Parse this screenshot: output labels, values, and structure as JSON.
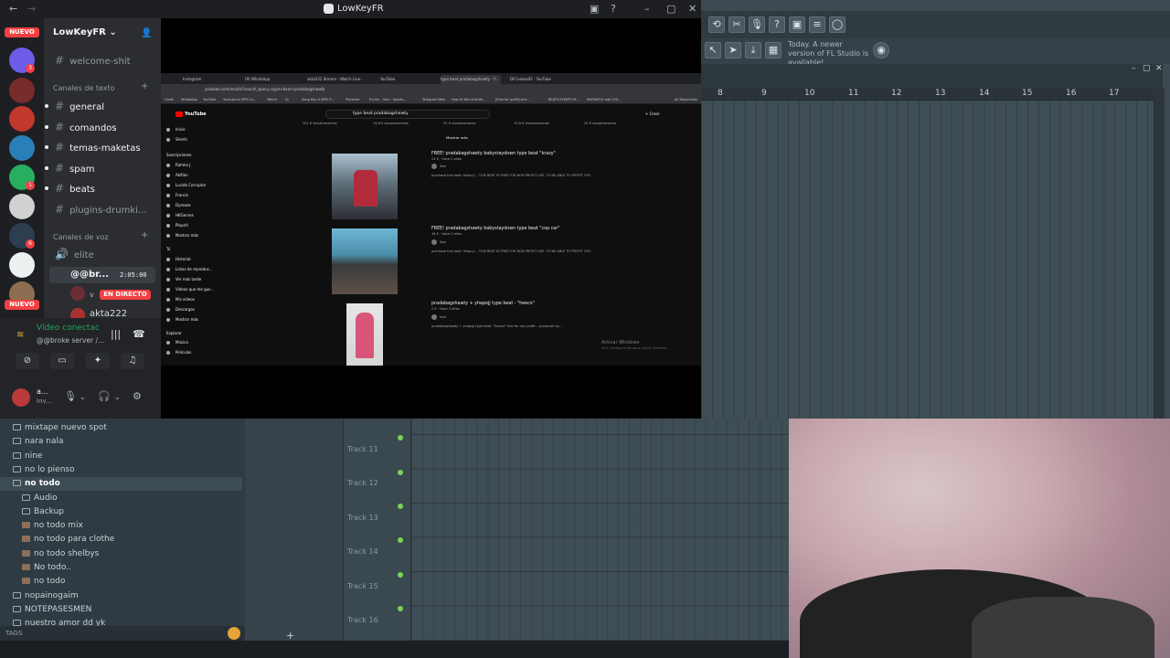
{
  "discord": {
    "window_title": "LowKeyFR",
    "server_name": "LowKeyFR",
    "server_badge_new": "NUEVO",
    "server_badge_new_bottom": "NUEVO",
    "server_badges": [
      "3",
      "1",
      "6"
    ],
    "channels_top": [
      {
        "name": "welcome-shit"
      }
    ],
    "text_category": "Canales de texto",
    "text_channels": [
      {
        "name": "general",
        "unread": true
      },
      {
        "name": "comandos",
        "unread": true
      },
      {
        "name": "temas-maketas",
        "unread": true
      },
      {
        "name": "spam",
        "unread": true
      },
      {
        "name": "beats",
        "unread": true
      },
      {
        "name": "plugins-drumki...",
        "unread": false
      }
    ],
    "voice_category": "Canales de voz",
    "voice_channels": [
      {
        "name": "elite"
      },
      {
        "name": "@@br...",
        "time": "2:05:00"
      }
    ],
    "voice_users": [
      {
        "name": "v",
        "badge": "EN DIRECTO"
      },
      {
        "name": "akta222"
      }
    ],
    "voice_panel": {
      "title": "Vídeo conectac",
      "subtitle": "@@broke server /..."
    },
    "user": {
      "name": "a...",
      "status": "Inv..."
    }
  },
  "browser": {
    "tabs": [
      "Instagram",
      "(9) WhatsApp",
      "akta222 Stream - Watch Live o...",
      "YouTube",
      "type beat pradabagshawty - Y...",
      "DFCoolwaSF - YouTube"
    ],
    "url": "youtube.com/results?search_query=type+beat+pradabagshawty",
    "bookmarks": [
      "Gmail",
      "WhatsApp",
      "YouTube",
      "Youtube to MP3 Co...",
      "Twitch",
      "IQ",
      "Song Key & BPM Fi...",
      "Pinterest",
      "Enrinn - Vine - Sports...",
      "Telegram Web",
      "How To Win And Ma...",
      "[Free for profit] sint...",
      "BEATS EVENTS M...",
      "INSTANTLY add 100...",
      "All Bookmarks"
    ],
    "yt_logo": "YouTube",
    "search_query": "type beat pradabagshawty",
    "create_label": "+ Crear",
    "filters": [
      "101 K visualizaciones",
      "14,8 K visualizaciones",
      "52 K visualizaciones",
      "13,8 K visualizaciones",
      "20 K visualizaciones"
    ],
    "sort_label": "Mostrar más",
    "sidebar_top": [
      "Inicio",
      "Shorts"
    ],
    "sidebar_subs_header": "Suscripciones",
    "sidebar_subs": [
      "Rahmx J",
      "Akifian",
      "Lucido Corruptor",
      "Francis",
      "Dyrease",
      "HKGenres",
      "Playsh!",
      "Mostrar más"
    ],
    "sidebar_you": [
      "Tú",
      "Historial",
      "Listas de reproduc...",
      "Ver más tarde",
      "Vídeos que me gus...",
      "Mis vídeos",
      "Descargas",
      "Mostrar más"
    ],
    "sidebar_explore_header": "Explorar",
    "sidebar_explore": [
      "Música",
      "Películas"
    ],
    "videos": [
      {
        "title": "FREE! pradabagshawty babystaydown type beat \"krazy\"",
        "meta": "24 K · Hace 2 años",
        "channel": "Ikon",
        "desc": "purchase this beat: https://...  THIS BEAT IS FREE FOR NON PROFIT USE. TO BE ABLE TO PROFIT OFF..."
      },
      {
        "title": "FREE! pradabagshawty babystaydown type beat \"cop car\"",
        "meta": "18 K · Hace 2 años",
        "channel": "Ikon",
        "desc": "purchase this beat: https://...  THIS BEAT IS FREE FOR NON PROFIT USE. TO BE ABLE TO PROFIT OFF..."
      },
      {
        "title": "pradabagshawty + yhapojj type beat - \"heeco\"",
        "meta": "2 K · Hace 3 años",
        "channel": "tdnr",
        "desc": "pradabagshawty + yhapojj type beat. \"Heeco\" free for non profit... produced by..."
      }
    ],
    "watermark_title": "Activar Windows",
    "watermark_sub": "Ve a Configuración para activar Windows."
  },
  "fl": {
    "notice": "Today. A newer version of FL Studio is available!",
    "ruler": [
      "8",
      "9",
      "10",
      "11",
      "12",
      "13",
      "14",
      "15",
      "16",
      "17"
    ],
    "tracks": [
      "Track 11",
      "Track 12",
      "Track 13",
      "Track 14",
      "Track 15",
      "Track 16"
    ],
    "browser_items": [
      {
        "label": "mixtape nuevo spot",
        "kind": "folder",
        "indent": 0,
        "selected": false
      },
      {
        "label": "nara nala",
        "kind": "folder",
        "indent": 0,
        "selected": false
      },
      {
        "label": "nine",
        "kind": "folder",
        "indent": 0,
        "selected": false
      },
      {
        "label": "no lo pienso",
        "kind": "folder",
        "indent": 0,
        "selected": false
      },
      {
        "label": "no todo",
        "kind": "folder",
        "indent": 0,
        "selected": true
      },
      {
        "label": "Audio",
        "kind": "folder",
        "indent": 1,
        "selected": false
      },
      {
        "label": "Backup",
        "kind": "folder",
        "indent": 1,
        "selected": false
      },
      {
        "label": "no todo mix",
        "kind": "file",
        "indent": 1,
        "selected": false
      },
      {
        "label": "no todo para clothe",
        "kind": "file",
        "indent": 1,
        "selected": false
      },
      {
        "label": "no todo shelbys",
        "kind": "file",
        "indent": 1,
        "selected": false
      },
      {
        "label": "No todo..",
        "kind": "file",
        "indent": 1,
        "selected": false
      },
      {
        "label": "no todo",
        "kind": "file",
        "indent": 1,
        "selected": false
      },
      {
        "label": "nopainogaim",
        "kind": "folder",
        "indent": 0,
        "selected": false
      },
      {
        "label": "NOTEPASESMEN",
        "kind": "folder",
        "indent": 0,
        "selected": false
      },
      {
        "label": "nuestro amor dd yk",
        "kind": "folder",
        "indent": 0,
        "selected": false
      }
    ],
    "tags_label": "TAGS"
  }
}
